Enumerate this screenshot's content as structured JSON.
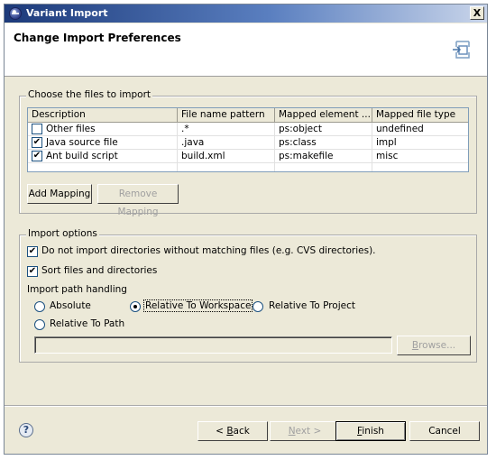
{
  "window": {
    "title": "Variant Import",
    "close_label": "X"
  },
  "banner": {
    "title": "Change Import Preferences",
    "icon": "import-wizard-icon"
  },
  "files_group": {
    "label": "Choose the files to import",
    "columns": [
      "Description",
      "File name pattern",
      "Mapped element ...",
      "Mapped file type"
    ],
    "rows": [
      {
        "checked": false,
        "description": "Other files",
        "pattern": ".*",
        "element": "ps:object",
        "type": "undefined"
      },
      {
        "checked": true,
        "description": "Java source file",
        "pattern": ".java",
        "element": "ps:class",
        "type": "impl"
      },
      {
        "checked": true,
        "description": "Ant build script",
        "pattern": "build.xml",
        "element": "ps:makefile",
        "type": "misc"
      }
    ],
    "add_mapping": "Add Mapping",
    "remove_mapping": "Remove Mapping"
  },
  "options_group": {
    "label": "Import options",
    "no_import_dirs": {
      "checked": true,
      "label": "Do not import directories without matching files (e.g. CVS directories)."
    },
    "sort_files": {
      "checked": true,
      "label": "Sort files and directories"
    },
    "path_handling_label": "Import path handling",
    "radios": [
      {
        "label": "Absolute",
        "selected": false
      },
      {
        "label": "Relative To Workspace",
        "selected": true
      },
      {
        "label": "Relative To Project",
        "selected": false
      },
      {
        "label": "Relative To Path",
        "selected": false
      }
    ],
    "path_value": "",
    "browse": "Browse..."
  },
  "footer": {
    "help_icon": "help-icon",
    "back_prefix": "< ",
    "back_mnemonic": "B",
    "back_rest": "ack",
    "next_mnemonic": "N",
    "next_rest": "ext >",
    "finish_mnemonic": "F",
    "finish_rest": "inish",
    "cancel": "Cancel"
  }
}
